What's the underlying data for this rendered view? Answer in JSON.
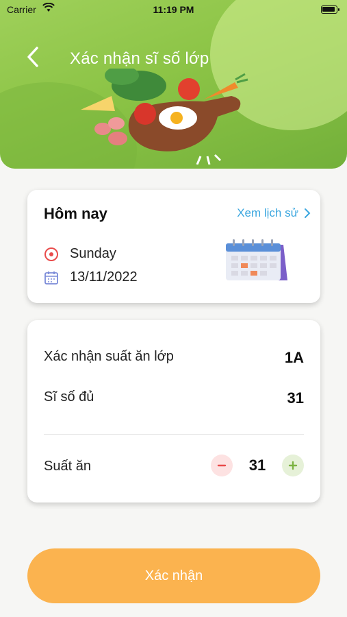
{
  "status_bar": {
    "carrier": "Carrier",
    "time": "11:19 PM"
  },
  "header": {
    "title": "Xác nhận sĩ số lớp"
  },
  "today_card": {
    "title": "Hôm nay",
    "history_link": "Xem lịch sử",
    "day": "Sunday",
    "date": "13/11/2022"
  },
  "confirm_card": {
    "class_label": "Xác nhận suất ăn lớp",
    "class_value": "1A",
    "attendance_label": "Sĩ số đủ",
    "attendance_value": "31",
    "meals_label": "Suất ăn",
    "meals_value": "31"
  },
  "submit_button": {
    "label": "Xác nhận"
  },
  "colors": {
    "header_green": "#8cc446",
    "link_blue": "#3aa6df",
    "button_orange": "#fbb34f",
    "minus_red": "#e94b4b",
    "plus_green": "#7cb342"
  },
  "icons": [
    "back-chevron-icon",
    "wifi-icon",
    "battery-icon",
    "chevron-right-icon",
    "radio-target-icon",
    "calendar-icon",
    "minus-icon",
    "plus-icon"
  ]
}
